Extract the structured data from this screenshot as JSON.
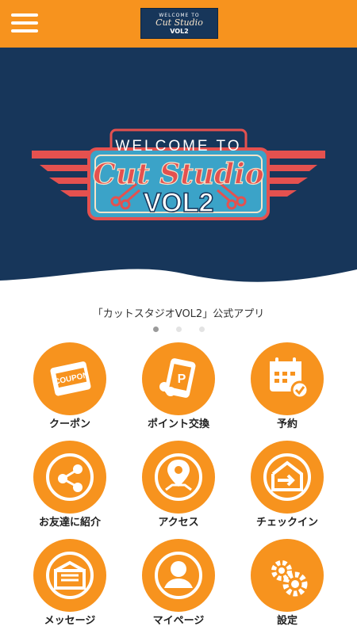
{
  "header": {
    "logo_top": "WELCOME TO",
    "logo_script": "Cut Studio",
    "logo_vol": "VOL2",
    "menu_icon": "hamburger-menu-icon"
  },
  "banner": {
    "welcome": "WELCOME TO",
    "script": "Cut Studio",
    "vol": "VOL2",
    "caption": "「カットスタジオVOL2」公式アプリ",
    "slides_total": 3,
    "slide_active": 1
  },
  "menu": [
    {
      "label": "クーポン",
      "icon": "coupon-icon",
      "badge": "COUPON"
    },
    {
      "label": "ポイント交換",
      "icon": "point-exchange-icon",
      "badge": "P"
    },
    {
      "label": "予約",
      "icon": "calendar-reserve-icon"
    },
    {
      "label": "お友達に紹介",
      "icon": "share-icon"
    },
    {
      "label": "アクセス",
      "icon": "map-pin-icon"
    },
    {
      "label": "チェックイン",
      "icon": "check-in-icon"
    },
    {
      "label": "メッセージ",
      "icon": "message-icon"
    },
    {
      "label": "マイページ",
      "icon": "user-profile-icon"
    },
    {
      "label": "設定",
      "icon": "gear-icon"
    }
  ],
  "colors": {
    "accent": "#f7931e",
    "banner_bg": "#17365a",
    "logo_panel": "#3ba3c8",
    "logo_red": "#e4514f"
  }
}
